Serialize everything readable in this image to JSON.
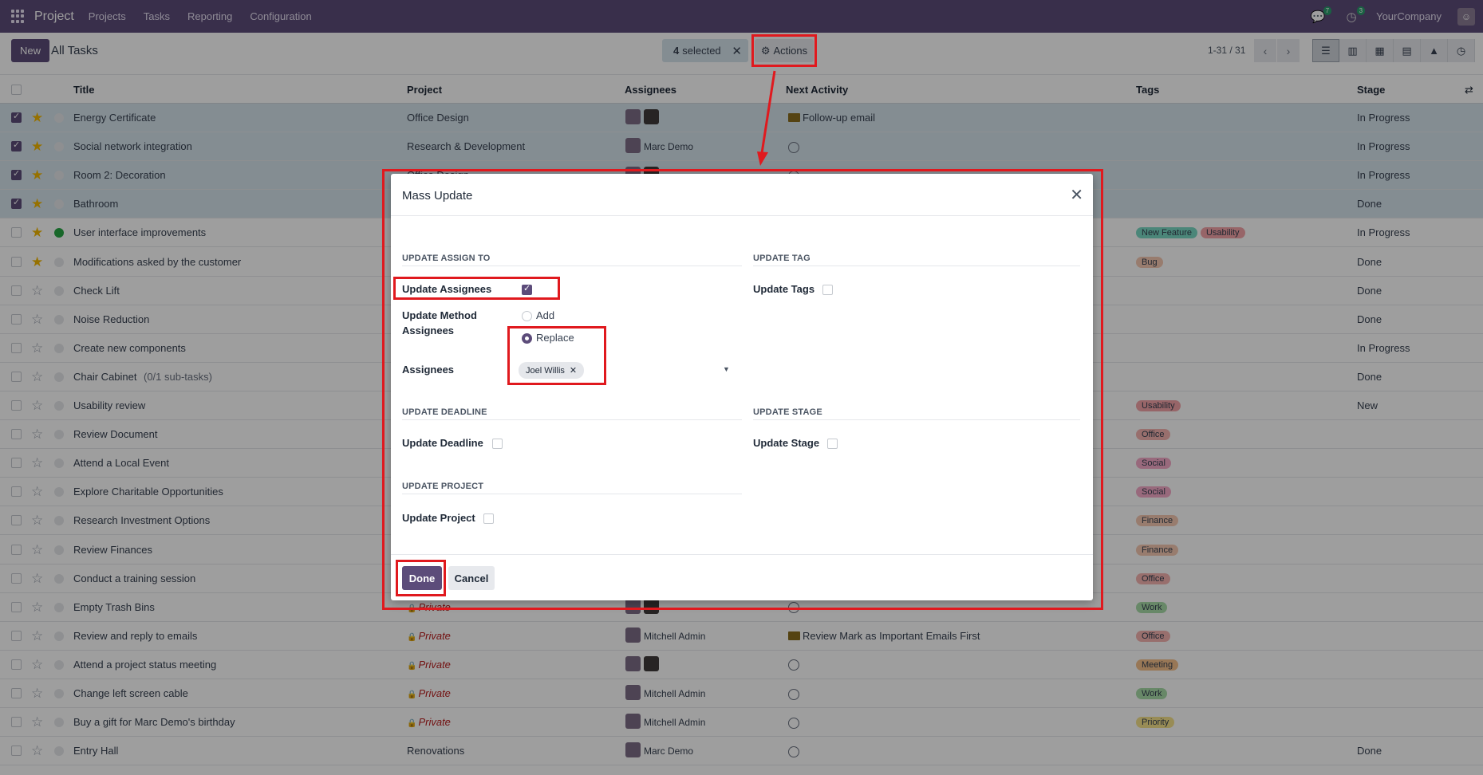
{
  "navbar": {
    "app_name": "Project",
    "menu": [
      "Projects",
      "Tasks",
      "Reporting",
      "Configuration"
    ],
    "messages_count": "7",
    "activities_count": "3",
    "company": "YourCompany"
  },
  "control": {
    "new_label": "New",
    "breadcrumb": "All Tasks",
    "selected_count": "4",
    "selected_label": "selected",
    "actions_label": "Actions",
    "pager": "1-31 / 31"
  },
  "table": {
    "headers": {
      "title": "Title",
      "project": "Project",
      "assignees": "Assignees",
      "next_activity": "Next Activity",
      "tags": "Tags",
      "stage": "Stage"
    },
    "rows": [
      {
        "title": "Energy Certificate",
        "project": "Office Design",
        "assignee": "",
        "activity": "Follow-up email",
        "tags": [],
        "stage": "In Progress"
      },
      {
        "title": "Social network integration",
        "project": "Research & Development",
        "assignee": "Marc Demo",
        "activity": "",
        "tags": [],
        "stage": "In Progress"
      },
      {
        "title": "Room 2: Decoration",
        "project": "Office Design",
        "assignee": "",
        "activity": "",
        "tags": [],
        "stage": "In Progress"
      },
      {
        "title": "Bathroom",
        "project": "",
        "assignee": "",
        "activity": "",
        "tags": [],
        "stage": "Done"
      },
      {
        "title": "User interface improvements",
        "project": "",
        "assignee": "",
        "activity": "",
        "tags": [
          "New Feature",
          "Usability"
        ],
        "stage": "In Progress"
      },
      {
        "title": "Modifications asked by the customer",
        "project": "",
        "assignee": "",
        "activity": "",
        "tags": [
          "Bug"
        ],
        "stage": "Done"
      },
      {
        "title": "Check Lift",
        "project": "",
        "assignee": "",
        "activity": "",
        "tags": [],
        "stage": "Done"
      },
      {
        "title": "Noise Reduction",
        "project": "",
        "assignee": "",
        "activity": "",
        "tags": [],
        "stage": "Done"
      },
      {
        "title": "Create new components",
        "project": "",
        "assignee": "",
        "activity": "",
        "tags": [],
        "stage": "In Progress"
      },
      {
        "title": "Chair Cabinet",
        "subtasks": "(0/1 sub-tasks)",
        "project": "",
        "assignee": "",
        "activity": "",
        "tags": [],
        "stage": "Done"
      },
      {
        "title": "Usability review",
        "project": "",
        "assignee": "",
        "activity": "",
        "tags": [
          "Usability"
        ],
        "stage": "New"
      },
      {
        "title": "Review Document",
        "project": "",
        "assignee": "",
        "activity": "",
        "tags": [
          "Office"
        ],
        "stage": ""
      },
      {
        "title": "Attend a Local Event",
        "project": "",
        "assignee": "",
        "activity": "",
        "tags": [
          "Social"
        ],
        "stage": ""
      },
      {
        "title": "Explore Charitable Opportunities",
        "project": "",
        "assignee": "",
        "activity": "",
        "tags": [
          "Social"
        ],
        "stage": ""
      },
      {
        "title": "Research Investment Options",
        "project": "",
        "assignee": "",
        "activity": "",
        "tags": [
          "Finance"
        ],
        "stage": ""
      },
      {
        "title": "Review Finances",
        "project": "",
        "assignee": "",
        "activity": "",
        "tags": [
          "Finance"
        ],
        "stage": ""
      },
      {
        "title": "Conduct a training session",
        "project": "",
        "assignee": "",
        "activity": "",
        "tags": [
          "Office"
        ],
        "stage": ""
      },
      {
        "title": "Empty Trash Bins",
        "project": "Private",
        "assignee": "",
        "activity": "",
        "tags": [
          "Work"
        ],
        "stage": ""
      },
      {
        "title": "Review and reply to emails",
        "project": "Private",
        "assignee": "Mitchell Admin",
        "activity": "Review Mark as Important Emails First",
        "tags": [
          "Office"
        ],
        "stage": ""
      },
      {
        "title": "Attend a project status meeting",
        "project": "Private",
        "assignee": "",
        "activity": "",
        "tags": [
          "Meeting"
        ],
        "stage": ""
      },
      {
        "title": "Change left screen cable",
        "project": "Private",
        "assignee": "Mitchell Admin",
        "activity": "",
        "tags": [
          "Work"
        ],
        "stage": ""
      },
      {
        "title": "Buy a gift for Marc Demo's birthday",
        "project": "Private",
        "assignee": "Mitchell Admin",
        "activity": "",
        "tags": [
          "Priority"
        ],
        "stage": ""
      },
      {
        "title": "Entry Hall",
        "project": "Renovations",
        "assignee": "Marc Demo",
        "activity": "",
        "tags": [],
        "stage": "Done"
      }
    ]
  },
  "tag_colors": {
    "New Feature": "#7ad9c4",
    "Usability": "#f4a3a8",
    "Bug": "#f5c9b2",
    "Office": "#f5b4b0",
    "Social": "#f5aac8",
    "Finance": "#f5c9b2",
    "Work": "#a9dca8",
    "Meeting": "#f5c18c",
    "Priority": "#f5e28c"
  },
  "modal": {
    "title": "Mass Update",
    "sec_assign": "UPDATE ASSIGN TO",
    "sec_tag": "UPDATE TAG",
    "sec_deadline": "UPDATE DEADLINE",
    "sec_stage": "UPDATE STAGE",
    "sec_project": "UPDATE PROJECT",
    "update_assignees": "Update Assignees",
    "update_method": "Update Method Assignees",
    "opt_add": "Add",
    "opt_replace": "Replace",
    "assignees_label": "Assignees",
    "assignee_chip": "Joel Willis",
    "update_tags": "Update Tags",
    "update_deadline": "Update Deadline",
    "update_stage": "Update Stage",
    "update_project": "Update Project",
    "done": "Done",
    "cancel": "Cancel"
  }
}
